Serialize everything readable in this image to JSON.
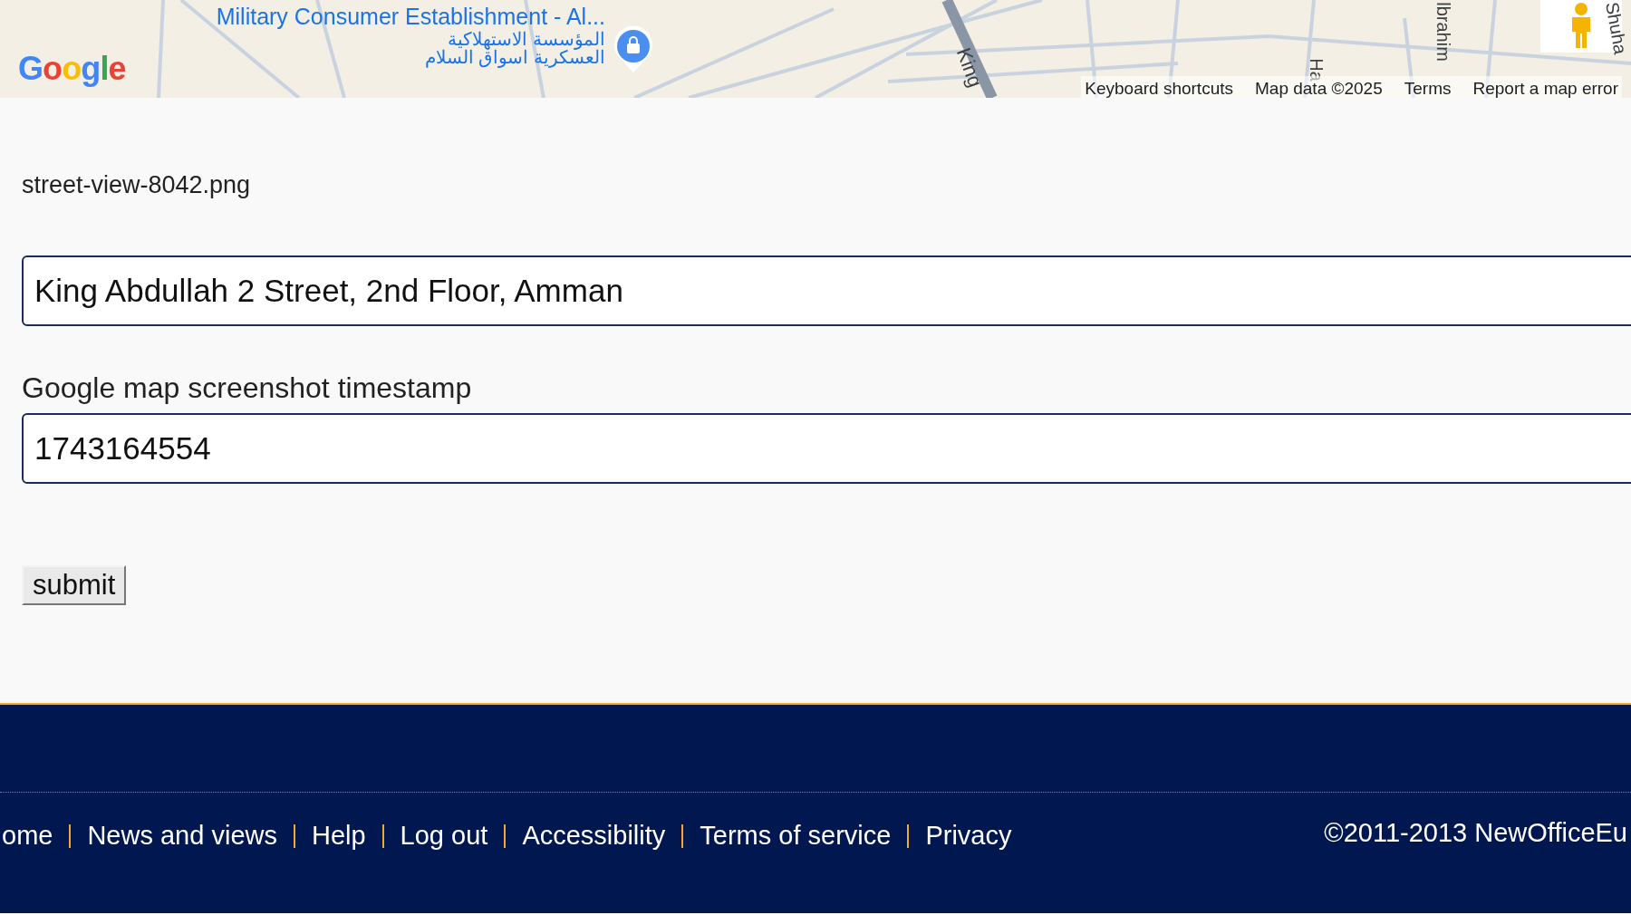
{
  "map": {
    "logo": "Google",
    "poi": {
      "name": "Military Consumer Establishment - Al...",
      "name_arabic_1": "المؤسسة الاستهلاكية",
      "name_arabic_2": "العسكرية اسواق السلام"
    },
    "street_labels": [
      "King",
      "Ha",
      "lbrahim",
      "Shuha"
    ],
    "attribution": [
      "Keyboard shortcuts",
      "Map data ©2025",
      "Terms",
      "Report a map error"
    ]
  },
  "form": {
    "filename": "street-view-8042.png",
    "address_value": "King Abdullah 2 Street, 2nd Floor, Amman",
    "timestamp_label": "Google map screenshot timestamp",
    "timestamp_value": "1743164554",
    "submit": "submit"
  },
  "footer": {
    "links": [
      "ome",
      "News and views",
      "Help",
      "Log out",
      "Accessibility",
      "Terms of service",
      "Privacy"
    ],
    "copyright": "©2011-2013 NewOfficeEu"
  }
}
